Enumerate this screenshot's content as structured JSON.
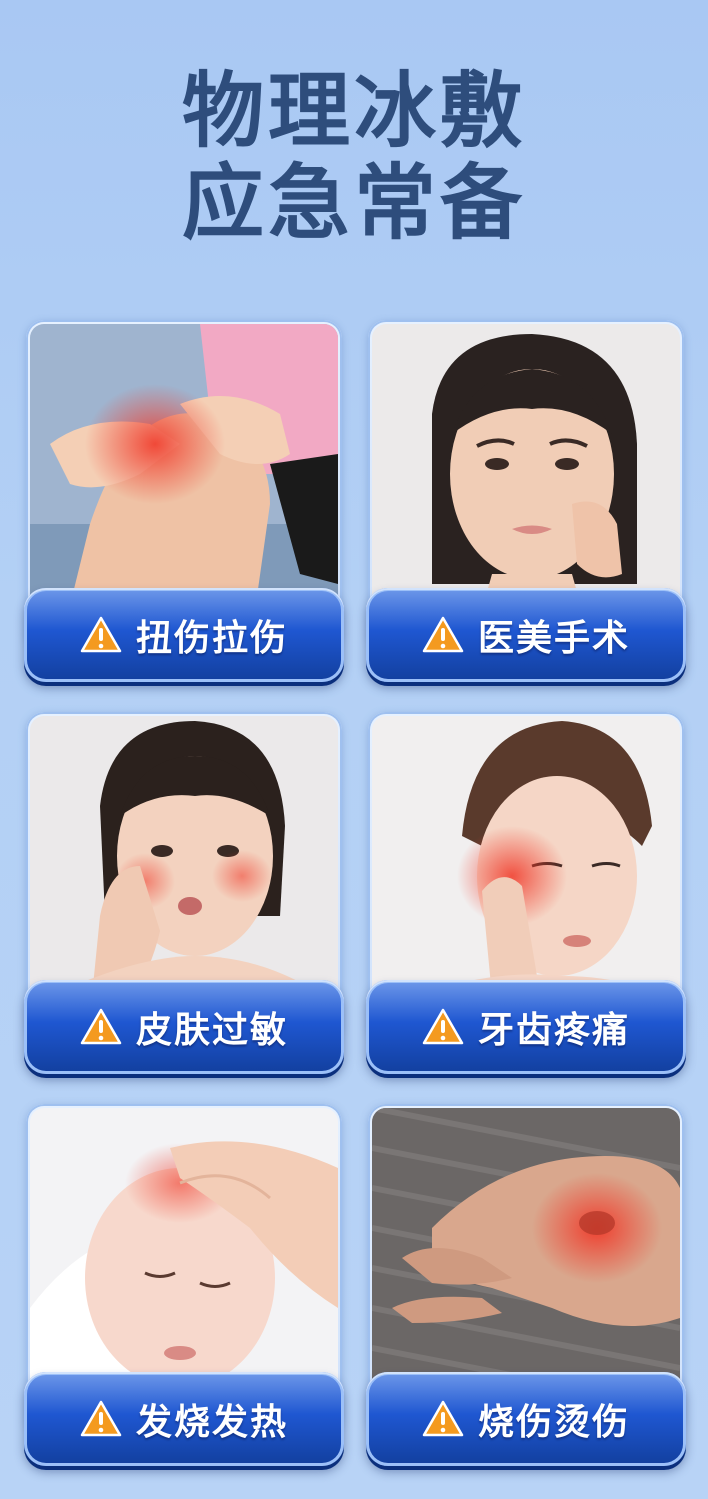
{
  "headline": {
    "line1": "物理冰敷",
    "line2": "应急常备"
  },
  "accent_colors": {
    "title": "#2e4d7c",
    "label_bar": "#1f57d1",
    "warning_icon": "#f49a1f",
    "pain_highlight": "#f03a2a"
  },
  "cards": [
    {
      "label": "扭伤拉伤",
      "icon": "warning-icon",
      "photo": "knee-injury-photo"
    },
    {
      "label": "医美手术",
      "icon": "warning-icon",
      "photo": "woman-cheek-photo"
    },
    {
      "label": "皮肤过敏",
      "icon": "warning-icon",
      "photo": "skin-allergy-photo"
    },
    {
      "label": "牙齿疼痛",
      "icon": "warning-icon",
      "photo": "toothache-photo"
    },
    {
      "label": "发烧发热",
      "icon": "warning-icon",
      "photo": "baby-fever-photo"
    },
    {
      "label": "烧伤烫伤",
      "icon": "warning-icon",
      "photo": "hand-burn-photo"
    }
  ]
}
